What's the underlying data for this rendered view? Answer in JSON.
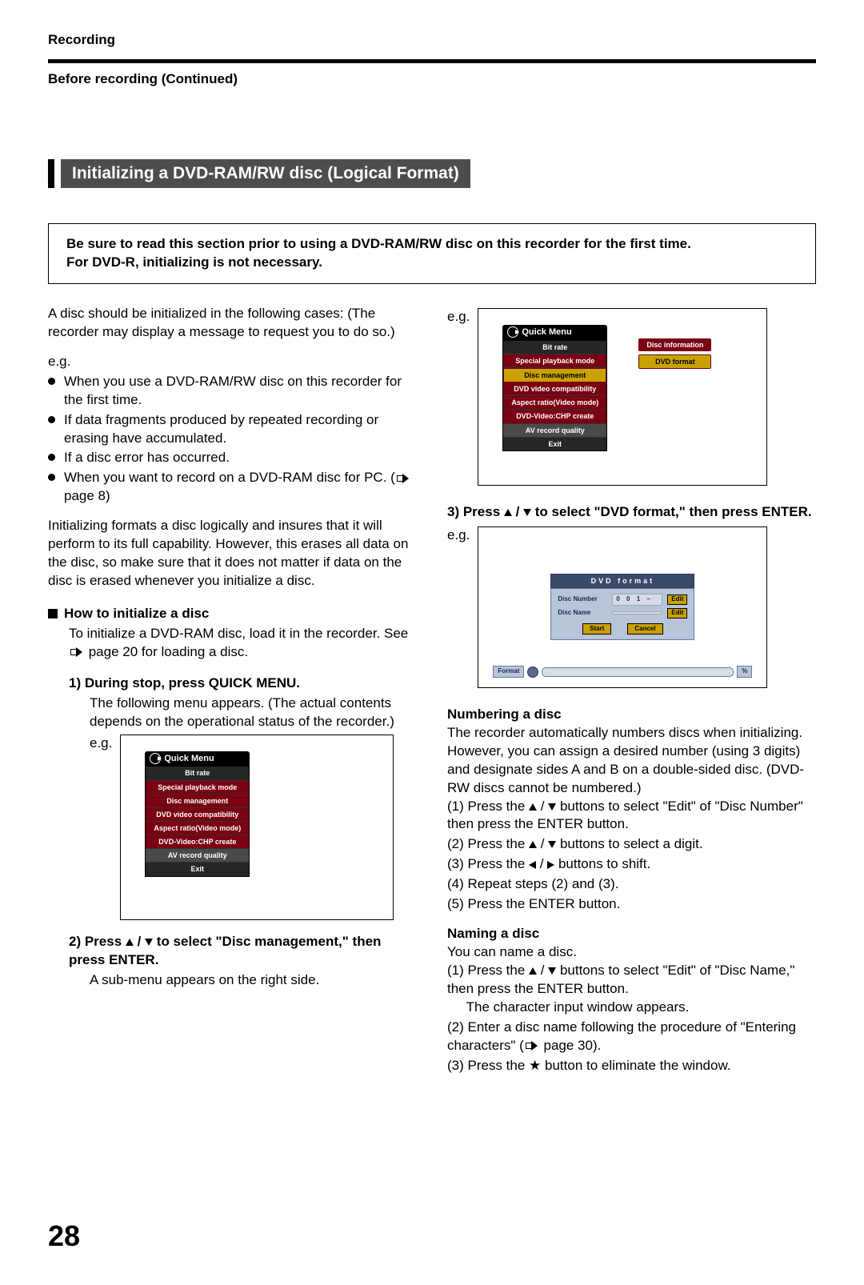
{
  "header": {
    "section": "Recording",
    "subsection": "Before recording (Continued)"
  },
  "title": "Initializing a DVD-RAM/RW disc (Logical Format)",
  "callout": {
    "line1": "Be sure to read this section prior to using a DVD-RAM/RW disc on this recorder for the first time.",
    "line2": "For DVD-R, initializing is not necessary."
  },
  "left": {
    "intro": "A disc should be initialized in the following cases: (The recorder may display a message to request you to do so.)",
    "eg": "e.g.",
    "bullets": {
      "b1": "When you use a DVD-RAM/RW disc on this recorder for the first time.",
      "b2": "If data fragments produced by repeated recording or erasing have accumulated.",
      "b3": "If a disc error has occurred.",
      "b4_pre": "When you want to record on a DVD-RAM disc for PC. (",
      "b4_post": " page 8)"
    },
    "para2": "Initializing formats a disc logically and insures that it will perform to its full capability. However, this erases all data on the disc, so make sure that it does not matter if data on the disc is erased whenever you initialize a disc.",
    "howto_head": "How to initialize a disc",
    "howto_p1a": "To initialize a DVD-RAM disc, load it in the recorder. See ",
    "howto_p1b": " page 20 for loading a disc.",
    "step1_head": "1) During stop, press QUICK MENU.",
    "step1_body": "The following menu appears. (The actual contents depends on the operational status of the recorder.)",
    "screen1_label": "e.g.",
    "step2_head_a": "2) Press ",
    "step2_head_mid": " / ",
    "step2_head_b": " to select \"Disc management,\" then press ENTER.",
    "step2_body": "A sub-menu appears on the right side."
  },
  "right": {
    "screen2_label": "e.g.",
    "step3_head_a": "3) Press ",
    "step3_head_mid": " / ",
    "step3_head_b": " to select \"DVD format,\" then press ENTER.",
    "screen3_label": "e.g.",
    "numbering_head": "Numbering a disc",
    "numbering_body": "The recorder automatically numbers discs when initializing. However, you can assign a desired number (using 3 digits) and designate sides A and B on a double-sided disc. (DVD-RW discs cannot be numbered.)",
    "num_steps": {
      "s1a": "(1) Press the ",
      "s1mid": " / ",
      "s1b": " buttons to select \"Edit\" of \"Disc Number\" then press the ENTER button.",
      "s2a": "(2) Press the ",
      "s2mid": " / ",
      "s2b": " buttons to select a digit.",
      "s3a": "(3) Press the ",
      "s3mid": " / ",
      "s3b": " buttons to shift.",
      "s4": "(4) Repeat steps (2) and (3).",
      "s5": "(5) Press the ENTER button."
    },
    "naming_head": "Naming a disc",
    "naming_body": "You can name a disc.",
    "name_steps": {
      "s1a": "(1) Press the ",
      "s1mid": " / ",
      "s1b": " buttons to select \"Edit\" of \"Disc Name,\" then press the ENTER button.",
      "s1c": "The character input window appears.",
      "s2a": "(2) Enter a disc name following the procedure of \"Entering characters\" (",
      "s2b": " page 30).",
      "s3a": "(3) Press the ",
      "s3b": " button to eliminate the window."
    }
  },
  "osd": {
    "qm_title": "Quick Menu",
    "items": {
      "bit_rate": "Bit rate",
      "spm": "Special playback mode",
      "disc_mgmt": "Disc management",
      "dvd_compat": "DVD video compatibility",
      "aspect": "Aspect ratio(Video mode)",
      "chp": "DVD-Video:CHP create",
      "avq": "AV record quality",
      "exit": "Exit"
    },
    "side": {
      "disc_info": "Disc information",
      "dvd_format": "DVD format"
    },
    "fmt": {
      "title": "DVD  format",
      "disc_number_lbl": "Disc Number",
      "disc_number_val": "0 0 1 –",
      "disc_name_lbl": "Disc Name",
      "edit": "Edit",
      "start": "Start",
      "cancel": "Cancel",
      "format_tag": "Format",
      "pct": "%"
    }
  },
  "page_number": "28"
}
